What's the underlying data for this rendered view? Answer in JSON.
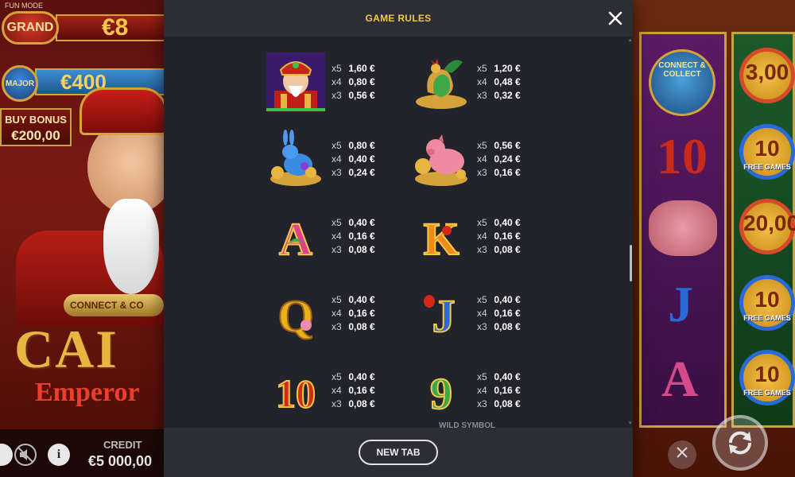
{
  "background": {
    "fun_mode": "FUN MODE",
    "jackpots": {
      "grand_label": "GRAND",
      "grand_value": "€8",
      "major_label": "MAJOR",
      "major_value": "€400"
    },
    "buy_bonus": {
      "line1": "BUY BONUS",
      "line2": "€200,00"
    },
    "logo": {
      "connect": "CONNECT & CO",
      "title": "CAI",
      "subtitle": "Emperor"
    },
    "credit": {
      "label": "CREDIT",
      "value": "€5 000,00"
    },
    "right_reels": {
      "connect_collect": "CONNECT & COLLECT",
      "coins": [
        {
          "value": "3,00",
          "sub": ""
        },
        {
          "value": "10",
          "sub": "FREE GAMES"
        },
        {
          "value": "20,00",
          "sub": ""
        },
        {
          "value": "10",
          "sub": "FREE GAMES"
        },
        {
          "value": "10",
          "sub": "FREE GAMES"
        }
      ],
      "symbols": [
        "10",
        "J",
        "A"
      ]
    },
    "icons": {
      "info": "i"
    }
  },
  "modal": {
    "title": "GAME RULES",
    "close_icon": "close-icon",
    "cut_off_text": "WILD SYMBOL",
    "footer_button": "NEW TAB",
    "paytable": [
      {
        "symbol": "emperor",
        "payouts": [
          {
            "mult": "x5",
            "amount": "1,60 €"
          },
          {
            "mult": "x4",
            "amount": "0,80 €"
          },
          {
            "mult": "x3",
            "amount": "0,56 €"
          }
        ]
      },
      {
        "symbol": "rooster",
        "payouts": [
          {
            "mult": "x5",
            "amount": "1,20 €"
          },
          {
            "mult": "x4",
            "amount": "0,48 €"
          },
          {
            "mult": "x3",
            "amount": "0,32 €"
          }
        ]
      },
      {
        "symbol": "rabbit",
        "payouts": [
          {
            "mult": "x5",
            "amount": "0,80 €"
          },
          {
            "mult": "x4",
            "amount": "0,40 €"
          },
          {
            "mult": "x3",
            "amount": "0,24 €"
          }
        ]
      },
      {
        "symbol": "pig",
        "payouts": [
          {
            "mult": "x5",
            "amount": "0,56 €"
          },
          {
            "mult": "x4",
            "amount": "0,24 €"
          },
          {
            "mult": "x3",
            "amount": "0,16 €"
          }
        ]
      },
      {
        "symbol": "A",
        "payouts": [
          {
            "mult": "x5",
            "amount": "0,40 €"
          },
          {
            "mult": "x4",
            "amount": "0,16 €"
          },
          {
            "mult": "x3",
            "amount": "0,08 €"
          }
        ]
      },
      {
        "symbol": "K",
        "payouts": [
          {
            "mult": "x5",
            "amount": "0,40 €"
          },
          {
            "mult": "x4",
            "amount": "0,16 €"
          },
          {
            "mult": "x3",
            "amount": "0,08 €"
          }
        ]
      },
      {
        "symbol": "Q",
        "payouts": [
          {
            "mult": "x5",
            "amount": "0,40 €"
          },
          {
            "mult": "x4",
            "amount": "0,16 €"
          },
          {
            "mult": "x3",
            "amount": "0,08 €"
          }
        ]
      },
      {
        "symbol": "J",
        "payouts": [
          {
            "mult": "x5",
            "amount": "0,40 €"
          },
          {
            "mult": "x4",
            "amount": "0,16 €"
          },
          {
            "mult": "x3",
            "amount": "0,08 €"
          }
        ]
      },
      {
        "symbol": "10",
        "payouts": [
          {
            "mult": "x5",
            "amount": "0,40 €"
          },
          {
            "mult": "x4",
            "amount": "0,16 €"
          },
          {
            "mult": "x3",
            "amount": "0,08 €"
          }
        ]
      },
      {
        "symbol": "9",
        "payouts": [
          {
            "mult": "x5",
            "amount": "0,40 €"
          },
          {
            "mult": "x4",
            "amount": "0,16 €"
          },
          {
            "mult": "x3",
            "amount": "0,08 €"
          }
        ]
      }
    ]
  },
  "colors": {
    "modal_bg": "#23232b",
    "header_bg": "#2c2d35",
    "title_accent": "#f2c84b",
    "text_primary": "#ffffff"
  }
}
